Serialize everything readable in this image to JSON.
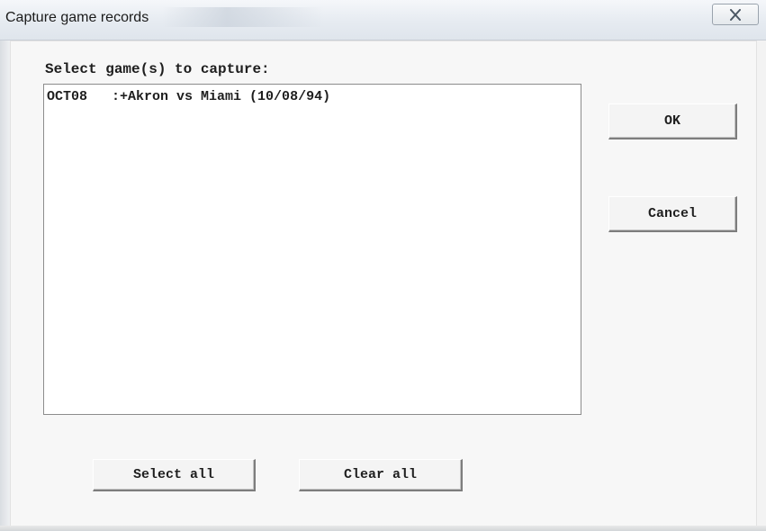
{
  "window": {
    "title": "Capture game records",
    "close_icon": "close-icon"
  },
  "dialog": {
    "prompt_label": "Select game(s) to capture:",
    "games": [
      {
        "code": "OCT08",
        "description": ":+Akron vs Miami (10/08/94)"
      }
    ]
  },
  "buttons": {
    "ok": "OK",
    "cancel": "Cancel",
    "select_all": "Select all",
    "clear_all": "Clear all"
  }
}
